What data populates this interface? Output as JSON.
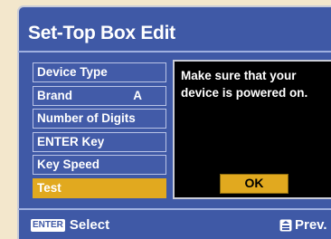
{
  "title": "Set-Top Box Edit",
  "menu": [
    {
      "label": "Device Type",
      "value": ""
    },
    {
      "label": "Brand",
      "value": "A"
    },
    {
      "label": "Number of Digits",
      "value": ""
    },
    {
      "label": "ENTER Key",
      "value": ""
    },
    {
      "label": "Key Speed",
      "value": ""
    },
    {
      "label": "Test",
      "value": "",
      "selected": true
    }
  ],
  "message": {
    "text": "Make sure that your device is powered on.",
    "ok_label": "OK"
  },
  "footer": {
    "enter_key": "ENTER",
    "select_label": "Select",
    "prev_label": "Prev."
  },
  "colors": {
    "panel": "#3f59a6",
    "highlight": "#e1a91f",
    "background": "#f3e7cc"
  }
}
